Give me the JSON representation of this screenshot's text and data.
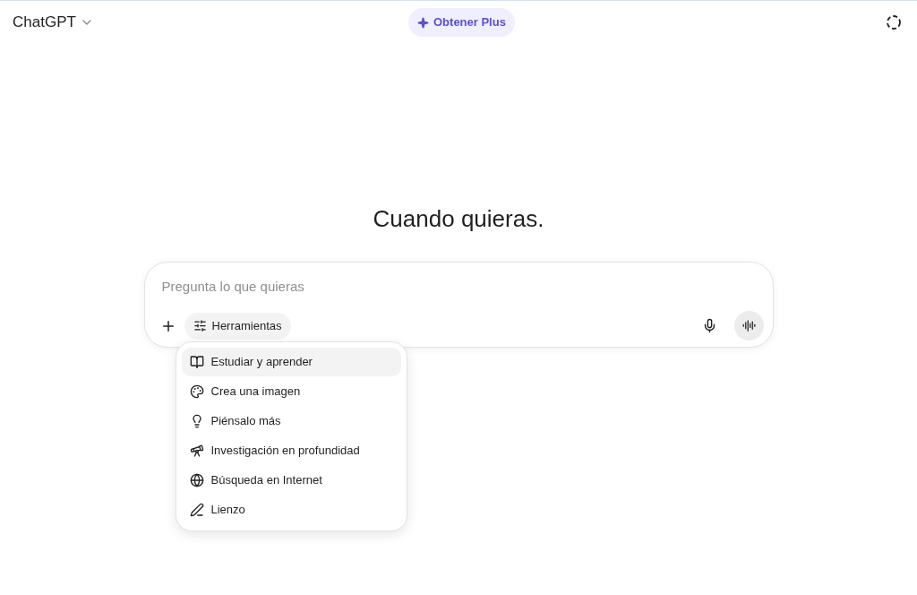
{
  "header": {
    "model": "ChatGPT",
    "upgrade": "Obtener Plus"
  },
  "heading": "Cuando quieras.",
  "composer": {
    "placeholder": "Pregunta lo que quieras",
    "tools_button": "Herramientas"
  },
  "tools_menu": [
    {
      "kind": "book",
      "label": "Estudiar y aprender",
      "selected": true
    },
    {
      "kind": "image",
      "label": "Crea una imagen",
      "selected": false
    },
    {
      "kind": "think",
      "label": "Piénsalo más",
      "selected": false
    },
    {
      "kind": "research",
      "label": "Investigación en profundidad",
      "selected": false
    },
    {
      "kind": "web",
      "label": "Búsqueda en Internet",
      "selected": false
    },
    {
      "kind": "canvas",
      "label": "Lienzo",
      "selected": false
    }
  ]
}
